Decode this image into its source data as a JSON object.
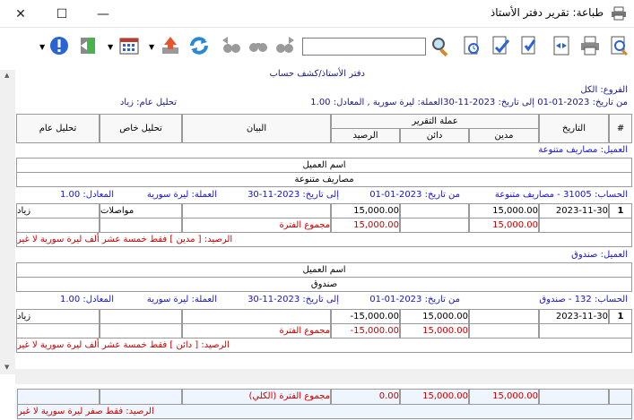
{
  "window": {
    "title": "طباعة: تقرير دفتر الأستاذ",
    "minimize": "—",
    "maximize": "☐",
    "close": "✕"
  },
  "toolbar": {
    "search_value": ""
  },
  "report": {
    "title": "دفتر الأستاذ/كشف حساب",
    "branches": "الفروع: الكل",
    "date_range": "من تاريخ: 2023-01-01   إلى تاريخ: 2023-11-30",
    "currency": "العملة: ليرة سورية , المعادل: 1.00",
    "general_analysis": "تحليل عام: زياد",
    "columns": {
      "num": "#",
      "date": "التاريخ",
      "report_currency": "عملة التقرير",
      "debit": "مدين",
      "credit": "دائن",
      "balance": "الرصيد",
      "statement": "البيان",
      "special_analysis": "تحليل خاص",
      "general_analysis": "تحليل عام"
    },
    "groups": [
      {
        "client_label": "العميل: مصاريف متنوعة",
        "client_name_header": "اسم العميل",
        "client_name": "مصاريف متنوعة",
        "account": "الحساب: 31005 - مصاريف متنوعة",
        "from": "من تاريخ: 2023-01-01",
        "to": "إلى تاريخ: 2023-11-30",
        "currency": "العملة: ليرة سورية",
        "equivalent": "المعادل: 1.00",
        "row": {
          "num": "1",
          "date": "2023-11-30",
          "debit": "15,000.00",
          "credit": "",
          "balance": "15,000.00",
          "statement": "",
          "special": "مواصلات",
          "general": "زياد"
        },
        "subtotal": {
          "debit": "15,000.00",
          "credit": "",
          "balance": "15,000.00",
          "label": "مجموع الفترة"
        },
        "balance_text": "الرصيد: [ مدين ] فقط خمسة عشر ألف ليرة سورية لا غير"
      },
      {
        "client_label": "العميل: صندوق",
        "client_name_header": "اسم العميل",
        "client_name": "صندوق",
        "account": "الحساب: 132 - صندوق",
        "from": "من تاريخ: 2023-01-01",
        "to": "إلى تاريخ: 2023-11-30",
        "currency": "العملة: ليرة سورية",
        "equivalent": "المعادل: 1.00",
        "row": {
          "num": "1",
          "date": "2023-11-30",
          "debit": "",
          "credit": "15,000.00",
          "balance": "15,000.00-",
          "statement": "",
          "special": "",
          "general": "زياد"
        },
        "subtotal": {
          "debit": "",
          "credit": "15,000.00",
          "balance": "15,000.00-",
          "label": "مجموع الفترة"
        },
        "balance_text": "الرصيد: [ دائن ] فقط خمسة عشر ألف ليرة سورية لا غير"
      }
    ],
    "total": {
      "debit": "15,000.00",
      "credit": "15,000.00",
      "balance": "0.00",
      "label": "مجموع الفترة (الكلي)",
      "balance_text": "الرصيد: فقط صفر ليرة سورية لا غير"
    }
  },
  "colors": {
    "navy": "#1a1a8c",
    "red": "#cc0000",
    "blue": "#1414d8",
    "grid": "#9a9a9a",
    "footer_bg": "#eef5fd"
  }
}
